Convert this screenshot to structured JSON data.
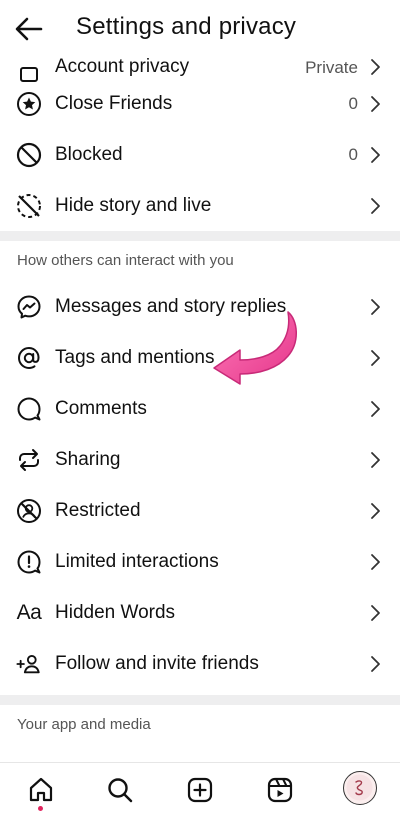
{
  "header": {
    "title": "Settings and privacy"
  },
  "account_privacy": {
    "label": "Account privacy",
    "value": "Private"
  },
  "rows_top": [
    {
      "label": "Close Friends",
      "value": "0",
      "icon": "star-circle-icon"
    },
    {
      "label": "Blocked",
      "value": "0",
      "icon": "blocked-icon"
    },
    {
      "label": "Hide story and live",
      "value": "",
      "icon": "hide-story-icon"
    }
  ],
  "section_interact": {
    "title": "How others can interact with you",
    "items": [
      {
        "label": "Messages and story replies",
        "icon": "messenger-icon"
      },
      {
        "label": "Tags and mentions",
        "icon": "at-sign-icon"
      },
      {
        "label": "Comments",
        "icon": "comment-icon"
      },
      {
        "label": "Sharing",
        "icon": "share-repost-icon"
      },
      {
        "label": "Restricted",
        "icon": "restricted-icon"
      },
      {
        "label": "Limited interactions",
        "icon": "limited-interactions-icon"
      },
      {
        "label": "Hidden Words",
        "icon": "text-aa-icon"
      },
      {
        "label": "Follow and invite friends",
        "icon": "add-person-icon"
      }
    ],
    "text_icon": "Aa"
  },
  "section_app": {
    "title": "Your app and media"
  },
  "colors": {
    "accent_arrow": "#f0509e",
    "notification_dot": "#e0245e",
    "divider": "#eeeeef"
  },
  "bottom_nav": [
    "home-icon",
    "search-icon",
    "create-icon",
    "reels-icon",
    "profile-avatar"
  ]
}
